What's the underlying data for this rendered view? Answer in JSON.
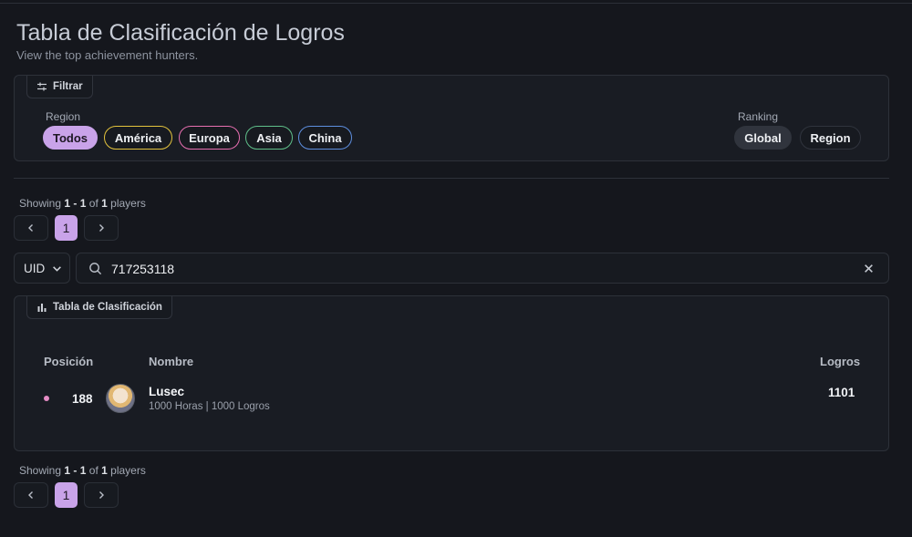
{
  "page": {
    "title": "Tabla de Clasificación de Logros",
    "subtitle": "View the top achievement hunters."
  },
  "filters": {
    "tab_label": "Filtrar",
    "tab_icon": "sliders-icon",
    "region_label": "Region",
    "regions": [
      {
        "label": "Todos",
        "active": true,
        "border": "#c9a3e9"
      },
      {
        "label": "América",
        "active": false,
        "border": "#e3c33d"
      },
      {
        "label": "Europa",
        "active": false,
        "border": "#e86fb1"
      },
      {
        "label": "Asia",
        "active": false,
        "border": "#5fc08a"
      },
      {
        "label": "China",
        "active": false,
        "border": "#5e8fe0"
      }
    ],
    "ranking_label": "Ranking",
    "rankings": [
      {
        "label": "Global",
        "active": true
      },
      {
        "label": "Region",
        "active": false
      }
    ]
  },
  "pagination": {
    "showing_prefix": "Showing",
    "from": "1",
    "dash": "-",
    "to": "1",
    "of_label": "of",
    "total": "1",
    "suffix": "players",
    "current_page": "1",
    "prev_icon": "chevron-left-icon",
    "next_icon": "chevron-right-icon"
  },
  "search": {
    "field_select": "UID",
    "value": "717253118",
    "search_icon": "search-icon",
    "clear_icon": "close-icon"
  },
  "leaderboard": {
    "tab_label": "Tabla de Clasificación",
    "tab_icon": "bar-chart-icon",
    "columns": {
      "position": "Posición",
      "name": "Nombre",
      "achievements": "Logros"
    },
    "rows": [
      {
        "position": "188",
        "name": "Lusec",
        "subtitle": "1000 Horas | 1000 Logros",
        "achievements": "1101",
        "dot_color": "#e58cc5"
      }
    ]
  },
  "colors": {
    "accent": "#c9a3e9",
    "background": "#15171d"
  }
}
